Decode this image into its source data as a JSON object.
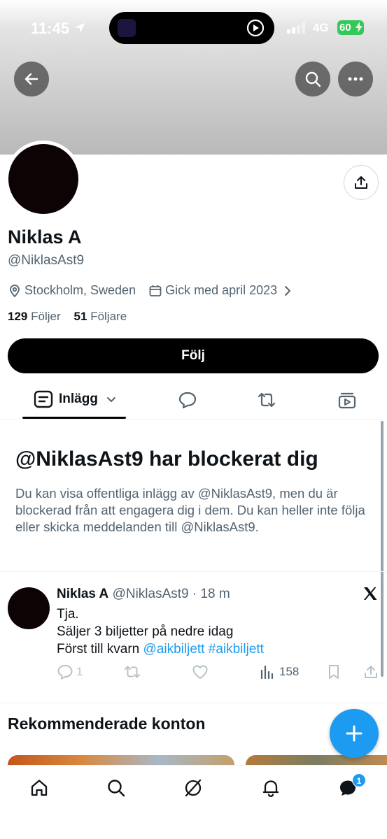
{
  "status_bar": {
    "time": "11:45",
    "network": "4G",
    "battery": "60"
  },
  "header": {
    "back_icon": "arrow-left-icon",
    "search_icon": "search-icon",
    "more_icon": "more-icon"
  },
  "profile": {
    "name": "Niklas A",
    "handle": "@NiklasAst9",
    "location": "Stockholm, Sweden",
    "joined": "Gick med april 2023",
    "following_count": "129",
    "following_label": "Följer",
    "followers_count": "51",
    "followers_label": "Följare",
    "follow_button": "Följ"
  },
  "tabs": {
    "posts_label": "Inlägg"
  },
  "blocked": {
    "title": "@NiklasAst9 har blockerat dig",
    "text": "Du kan visa offentliga inlägg av @NiklasAst9, men du är blockerad från att engagera dig i dem. Du kan heller inte följa eller skicka meddelanden till @NiklasAst9."
  },
  "tweet": {
    "author": "Niklas A",
    "handle_time": "@NiklasAst9 · 18 m",
    "line1": "Tja.",
    "line2": "Säljer 3 biljetter på nedre idag",
    "line3_prefix": "Först till kvarn ",
    "mention": "@aikbiljett",
    "hashtag": "#aikbiljett",
    "replies": "1",
    "views": "158"
  },
  "recommended": {
    "title": "Rekommenderade konton"
  },
  "nav": {
    "messages_badge": "1"
  },
  "colors": {
    "accent": "#1d9bf0",
    "text": "#0f1419",
    "secondary": "#536471",
    "battery": "#34c759"
  }
}
